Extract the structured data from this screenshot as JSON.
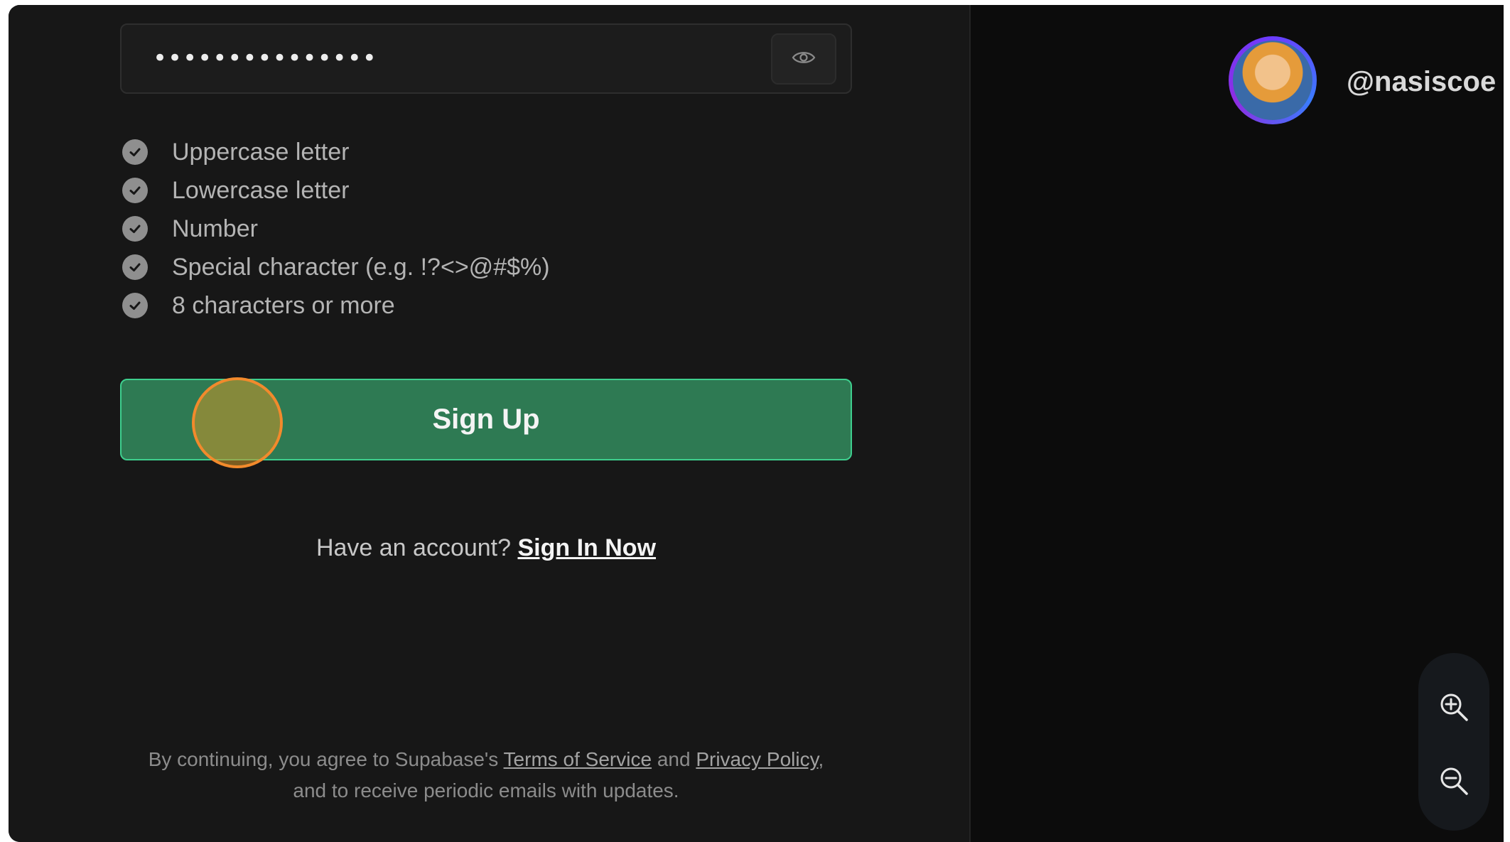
{
  "form": {
    "password_value": "•••••••••••••••",
    "requirements": [
      "Uppercase letter",
      "Lowercase letter",
      "Number",
      "Special character (e.g. !?<>@#$%)",
      "8 characters or more"
    ],
    "signup_label": "Sign Up",
    "have_account_text": "Have an account?",
    "sign_in_label": "Sign In Now",
    "legal": {
      "prefix": "By continuing, you agree to Supabase's",
      "terms": "Terms of Service",
      "and": "and",
      "privacy": "Privacy Policy",
      "suffix": ", and to receive periodic emails with updates."
    }
  },
  "profile": {
    "handle": "@nasiscoe"
  },
  "colors": {
    "accent": "#3ecf8e",
    "button_fill": "#2e7a53",
    "background": "#171717",
    "click_marker": "#f28a2c"
  },
  "icons": {
    "password_toggle": "eye-icon",
    "requirement": "check-circle-icon",
    "zoom_in": "zoom-in-icon",
    "zoom_out": "zoom-out-icon"
  }
}
